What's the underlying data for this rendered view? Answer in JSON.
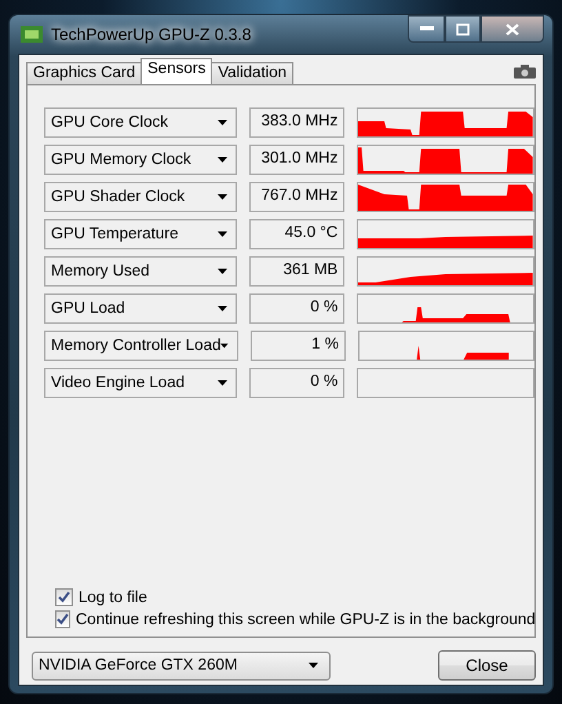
{
  "window": {
    "title": "TechPowerUp GPU-Z 0.3.8"
  },
  "tabs": [
    {
      "label": "Graphics Card",
      "selected": false
    },
    {
      "label": "Sensors",
      "selected": true
    },
    {
      "label": "Validation",
      "selected": false
    }
  ],
  "sensors": [
    {
      "name": "GPU Core Clock",
      "value": "383.0 MHz"
    },
    {
      "name": "GPU Memory Clock",
      "value": "301.0 MHz"
    },
    {
      "name": "GPU Shader Clock",
      "value": "767.0 MHz"
    },
    {
      "name": "GPU Temperature",
      "value": "45.0 °C"
    },
    {
      "name": "Memory Used",
      "value": "361 MB"
    },
    {
      "name": "GPU Load",
      "value": "0 %"
    },
    {
      "name": "Memory Controller Load",
      "value": "1 %"
    },
    {
      "name": "Video Engine Load",
      "value": "0 %"
    }
  ],
  "options": [
    {
      "label": "Log to file",
      "checked": true
    },
    {
      "label": "Continue refreshing this screen while GPU-Z is in the background",
      "checked": true
    }
  ],
  "device_select": {
    "value": "NVIDIA GeForce GTX 260M"
  },
  "buttons": [
    {
      "label": "Close"
    }
  ]
}
